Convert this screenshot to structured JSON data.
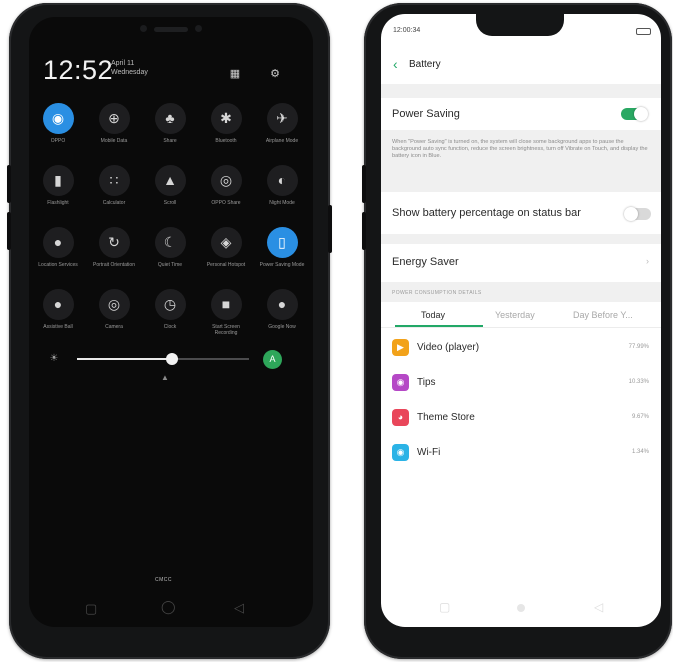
{
  "quick_settings": {
    "time": "12:52",
    "date_line1": "April 11",
    "date_line2": "Wednesday",
    "tiles": [
      {
        "label": "OPPO",
        "icon": "wifi-icon",
        "glyph": "◉",
        "on": true
      },
      {
        "label": "Mobile Data",
        "icon": "mobile-data-icon",
        "glyph": "⊕",
        "on": false
      },
      {
        "label": "Share",
        "icon": "share-icon",
        "glyph": "♣",
        "on": false
      },
      {
        "label": "Bluetooth",
        "icon": "bluetooth-icon",
        "glyph": "✱",
        "on": false
      },
      {
        "label": "Airplane Mode",
        "icon": "airplane-icon",
        "glyph": "✈",
        "on": false
      },
      {
        "label": "Flashlight",
        "icon": "flashlight-icon",
        "glyph": "▮",
        "on": false
      },
      {
        "label": "Calculator",
        "icon": "calculator-icon",
        "glyph": "∷",
        "on": false
      },
      {
        "label": "Scroll",
        "icon": "scroll-icon",
        "glyph": "▲",
        "on": false
      },
      {
        "label": "OPPO Share",
        "icon": "oppo-share-icon",
        "glyph": "◎",
        "on": false
      },
      {
        "label": "Night Mode",
        "icon": "night-mode-icon",
        "glyph": "◐",
        "on": false
      },
      {
        "label": "Location Services",
        "icon": "location-icon",
        "glyph": "●",
        "on": false
      },
      {
        "label": "Portrait Orientation",
        "icon": "rotation-lock-icon",
        "glyph": "↻",
        "on": false
      },
      {
        "label": "Quiet Time",
        "icon": "moon-icon",
        "glyph": "☾",
        "on": false
      },
      {
        "label": "Personal Hotspot",
        "icon": "hotspot-icon",
        "glyph": "◈",
        "on": false
      },
      {
        "label": "Power Saving Mode",
        "icon": "battery-saver-icon",
        "glyph": "▯",
        "on": true
      },
      {
        "label": "Assistive Ball",
        "icon": "assistive-ball-icon",
        "glyph": "●",
        "on": false
      },
      {
        "label": "Camera",
        "icon": "camera-icon",
        "glyph": "◎",
        "on": false
      },
      {
        "label": "Clock",
        "icon": "clock-icon",
        "glyph": "◷",
        "on": false
      },
      {
        "label": "Start Screen Recording",
        "icon": "screen-record-icon",
        "glyph": "■",
        "on": false
      },
      {
        "label": "Google Now",
        "icon": "microphone-icon",
        "glyph": "●",
        "on": false
      }
    ],
    "brightness_level": 0.55,
    "carrier": "CMCC"
  },
  "battery_screen": {
    "status_time": "12:00:34",
    "title": "Battery",
    "power_saving": {
      "label": "Power Saving",
      "on": true,
      "description": "When \"Power Saving\" is turned on, the system will close some background apps to pause the background auto sync function, reduce the screen brightness, turn off Vibrate on Touch, and display the battery icon in Blue."
    },
    "show_percentage": {
      "label": "Show battery percentage on status bar",
      "on": false
    },
    "energy_saver": {
      "label": "Energy Saver"
    },
    "consumption_header": "POWER CONSUMPTION DETAILS",
    "tabs": [
      "Today",
      "Yesterday",
      "Day Before Y..."
    ],
    "apps": [
      {
        "name": "Video (player)",
        "percent": "77.99%",
        "color": "#f2a21a",
        "icon": "video-player-icon",
        "glyph": "▶"
      },
      {
        "name": "Tips",
        "percent": "10.33%",
        "color": "#b548c6",
        "icon": "tips-icon",
        "glyph": "◉"
      },
      {
        "name": "Theme Store",
        "percent": "9.67%",
        "color": "#e9465a",
        "icon": "theme-store-icon",
        "glyph": "◕"
      },
      {
        "name": "Wi-Fi",
        "percent": "1.34%",
        "color": "#2bb3e6",
        "icon": "wifi-app-icon",
        "glyph": "◉"
      }
    ]
  }
}
